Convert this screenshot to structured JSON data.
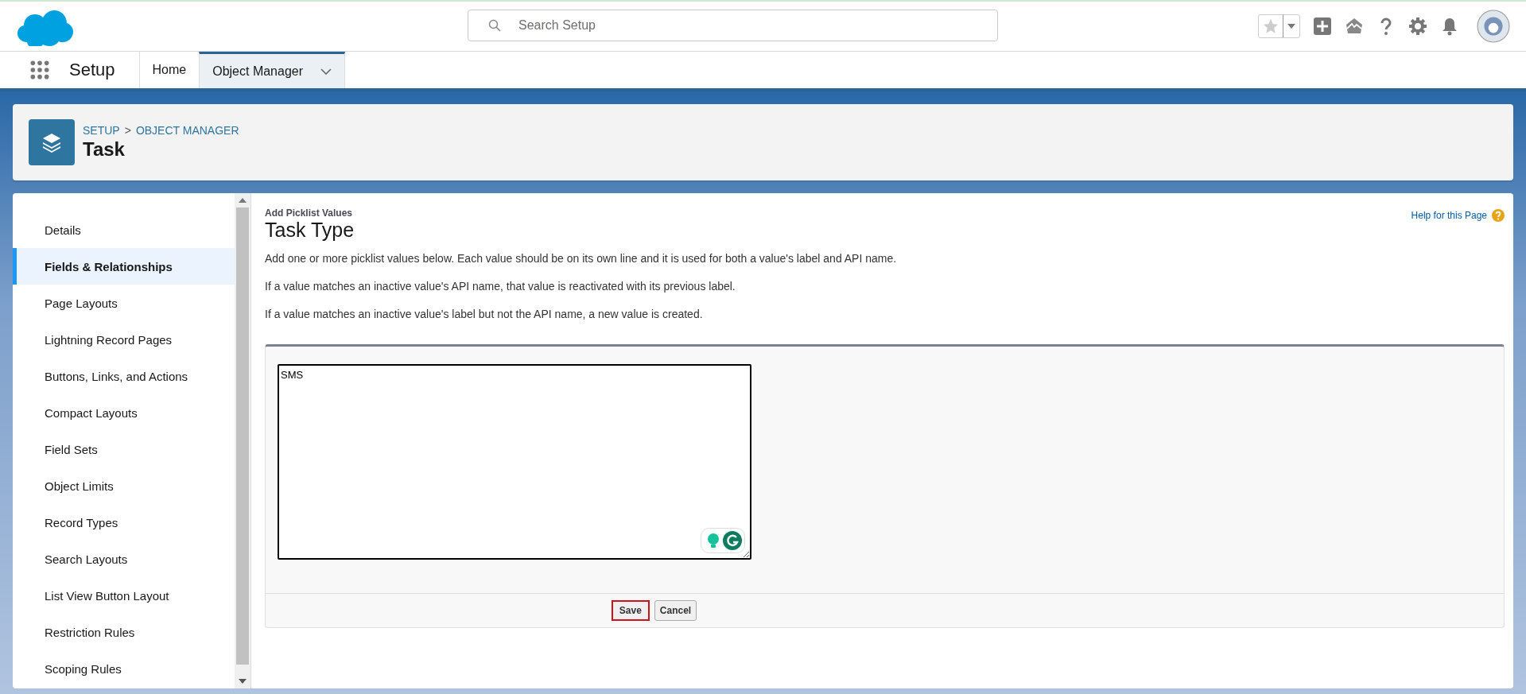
{
  "header": {
    "search": {
      "placeholder": "Search Setup"
    }
  },
  "nav": {
    "app_name": "Setup",
    "tabs": [
      {
        "label": "Home",
        "selected": false,
        "dropdown": false
      },
      {
        "label": "Object Manager",
        "selected": true,
        "dropdown": true
      }
    ]
  },
  "page_header": {
    "breadcrumbs": [
      "SETUP",
      "OBJECT MANAGER"
    ],
    "breadcrumb_separator": ">",
    "title": "Task"
  },
  "sidebar": {
    "items": [
      {
        "label": "Details",
        "selected": false
      },
      {
        "label": "Fields & Relationships",
        "selected": true
      },
      {
        "label": "Page Layouts",
        "selected": false
      },
      {
        "label": "Lightning Record Pages",
        "selected": false
      },
      {
        "label": "Buttons, Links, and Actions",
        "selected": false
      },
      {
        "label": "Compact Layouts",
        "selected": false
      },
      {
        "label": "Field Sets",
        "selected": false
      },
      {
        "label": "Object Limits",
        "selected": false
      },
      {
        "label": "Record Types",
        "selected": false
      },
      {
        "label": "Search Layouts",
        "selected": false
      },
      {
        "label": "List View Button Layout",
        "selected": false
      },
      {
        "label": "Restriction Rules",
        "selected": false
      },
      {
        "label": "Scoping Rules",
        "selected": false
      }
    ]
  },
  "content": {
    "subtitle": "Add Picklist Values",
    "title": "Task Type",
    "help_link": "Help for this Page",
    "paragraphs": [
      "Add one or more picklist values below. Each value should be on its own line and it is used for both a value's label and API name.",
      "If a value matches an inactive value's API name, that value is reactivated with its previous label.",
      "If a value matches an inactive value's label but not the API name, a new value is created."
    ],
    "values_field": {
      "value": "SMS"
    },
    "buttons": [
      {
        "label": "Save",
        "focused": true
      },
      {
        "label": "Cancel",
        "focused": false
      }
    ]
  }
}
